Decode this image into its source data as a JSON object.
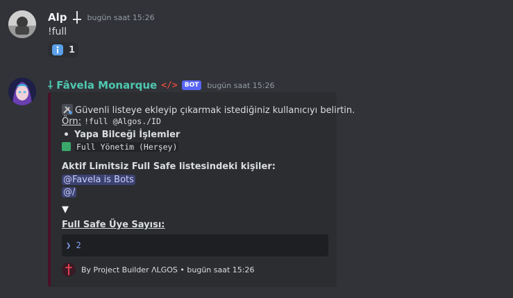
{
  "messages": [
    {
      "username": "Alp",
      "timestamp": "bugün saat 15:26",
      "text": "!full",
      "reaction": {
        "icon": "info-icon",
        "count": "1"
      }
    },
    {
      "username": "⸸ Fâvela Monarque",
      "tag_symbol": "</>",
      "badge": "BOT",
      "timestamp": "bugün saat 15:26",
      "embed": {
        "description": "Güvenli listeye ekleyip çıkarmak istediğiniz kullanıcıyı belirtin.",
        "example_label": "Örn:",
        "example_code": "!full @Algos./ID",
        "bullet_title": "Yapa Bilceği İşlemler",
        "item_code": "Full Yönetim (Herşey)",
        "list_heading": "Aktif Limitsiz Full Safe listesindeki kişiler:",
        "mentions": [
          "@Favela is Bots",
          "@/"
        ],
        "arrow": "▼",
        "count_heading": "Full Safe Üye Sayısı:",
        "count_value": "❯ 2",
        "footer": "By Project Builder ΛLGOS • bugün saat 15:26"
      }
    }
  ],
  "colors": {
    "background": "#313338",
    "bot_name": "#4ec9b0",
    "badge": "#5865f2",
    "embed_border": "#4b0f27"
  }
}
